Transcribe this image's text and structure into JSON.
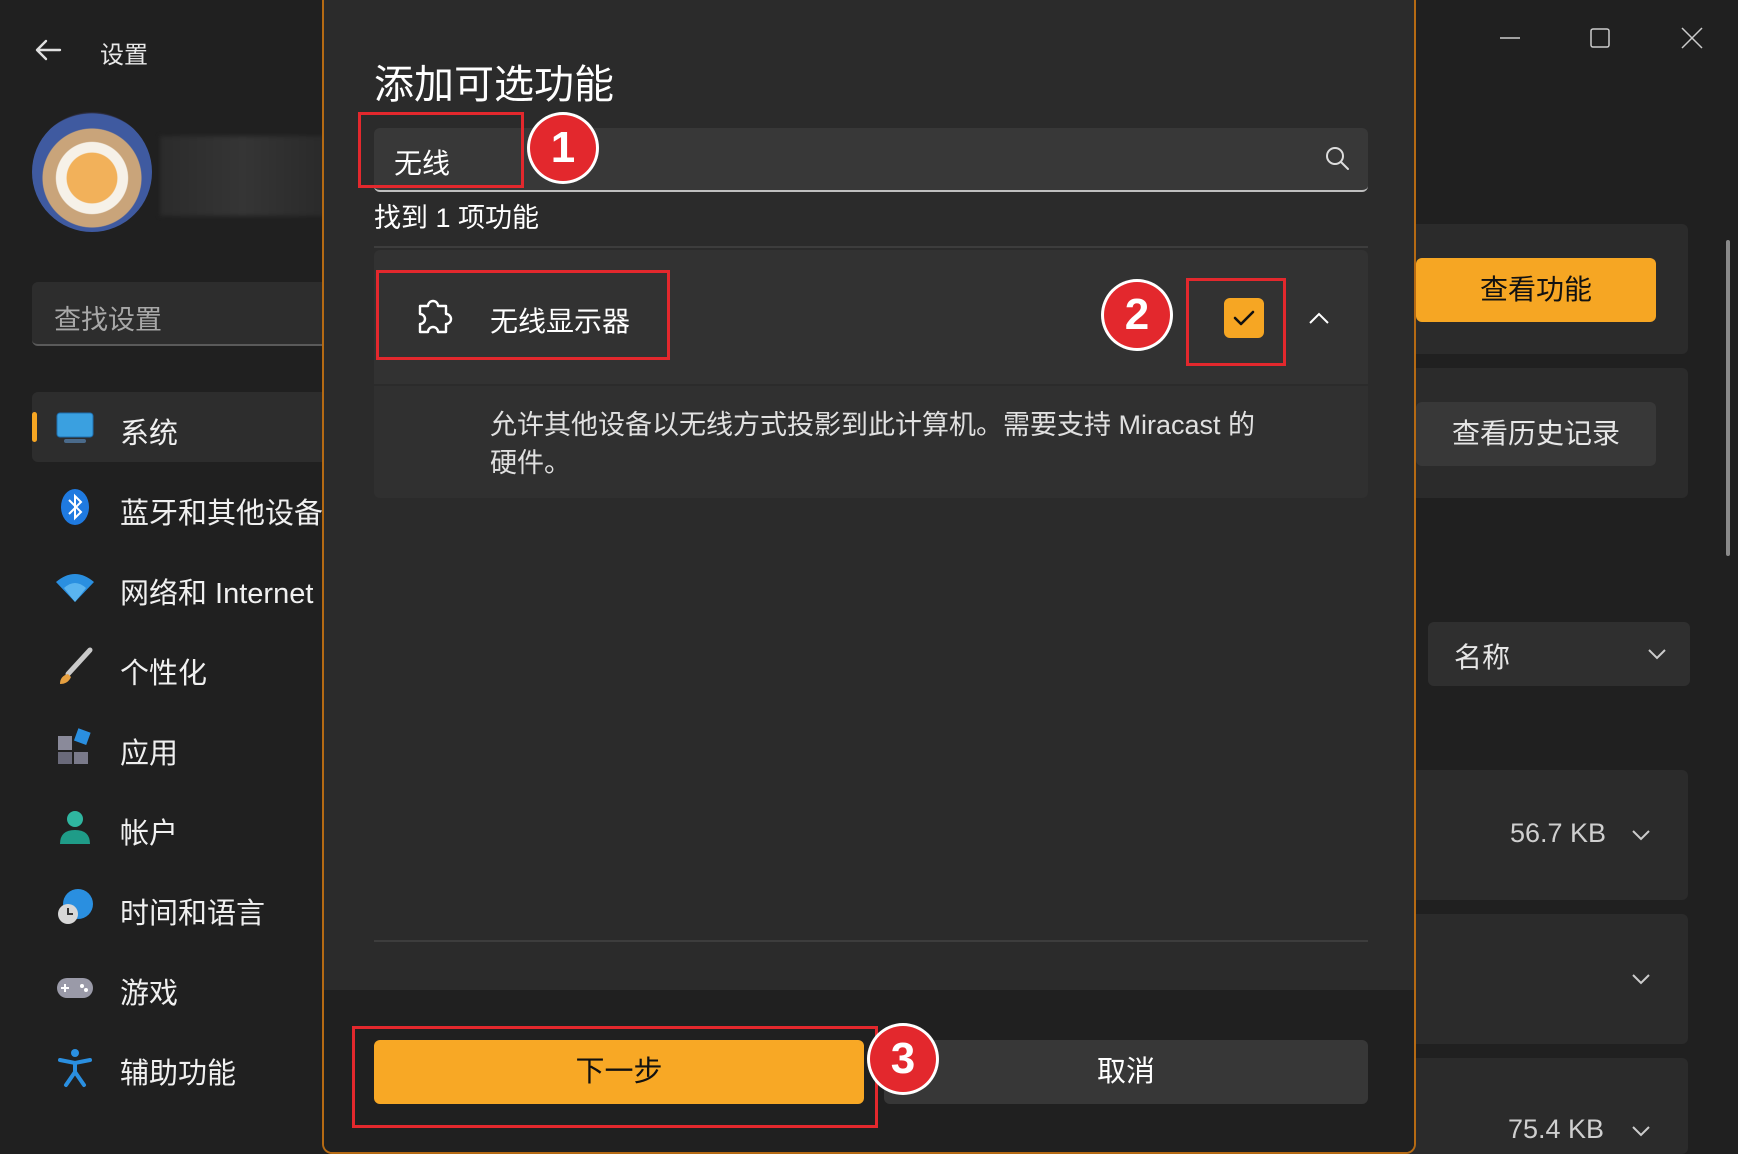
{
  "window": {
    "title": "设置",
    "back_icon": "arrow-left-icon",
    "controls": [
      "minimize-icon",
      "maximize-icon",
      "close-icon"
    ]
  },
  "sidebar": {
    "search_placeholder": "查找设置",
    "items": [
      {
        "label": "系统",
        "icon": "monitor-icon",
        "active": true
      },
      {
        "label": "蓝牙和其他设备",
        "icon": "bluetooth-icon"
      },
      {
        "label": "网络和 Internet",
        "icon": "wifi-icon"
      },
      {
        "label": "个性化",
        "icon": "brush-icon"
      },
      {
        "label": "应用",
        "icon": "apps-icon"
      },
      {
        "label": "帐户",
        "icon": "person-icon"
      },
      {
        "label": "时间和语言",
        "icon": "globe-clock-icon"
      },
      {
        "label": "游戏",
        "icon": "gamepad-icon"
      },
      {
        "label": "辅助功能",
        "icon": "accessibility-icon"
      }
    ]
  },
  "background": {
    "view_features_button": "查看功能",
    "view_history_button": "查看历史记录",
    "sort_select_value": "名称",
    "sizes": [
      "56.7 KB",
      "75.4 KB"
    ]
  },
  "dialog": {
    "title": "添加可选功能",
    "search_value": "无线",
    "found_text": "找到 1 项功能",
    "feature": {
      "name": "无线显示器",
      "checked": true,
      "description": "允许其他设备以无线方式投影到此计算机。需要支持 Miracast 的硬件。"
    },
    "next_button": "下一步",
    "cancel_button": "取消"
  },
  "annotations": {
    "step1": "1",
    "step2": "2",
    "step3": "3"
  },
  "colors": {
    "accent": "#f6a623",
    "annotation_red": "#e3282d",
    "background": "#202020",
    "dialog": "#2b2b2b"
  }
}
